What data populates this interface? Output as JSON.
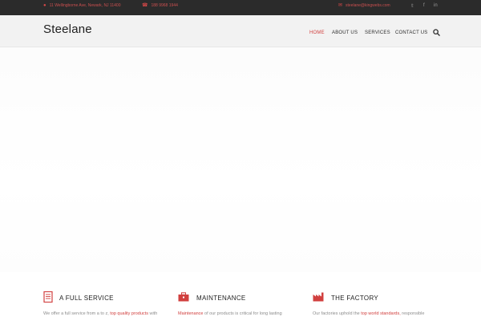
{
  "topbar": {
    "address": "11 Wellingborne Ave, Newark, NJ 11400",
    "phone": "188 9968 1944",
    "email": "steelane@kingwebs.com",
    "social": [
      "twitter-icon",
      "facebook-icon",
      "linkedin-icon"
    ]
  },
  "header": {
    "logo": "Steelane",
    "nav": [
      "HOME",
      "ABOUT US",
      "SERVICES",
      "CONTACT US"
    ],
    "active_index": 0
  },
  "features": [
    {
      "icon": "document-icon",
      "title": "A FULL SERVICE",
      "text_pre": "We offer a full service from a to z,",
      "highlight": "top quality products",
      "text_post": "with"
    },
    {
      "icon": "toolbox-icon",
      "title": "MAINTENANCE",
      "text_pre": "",
      "highlight": "Maintenance",
      "text_post": "of our products is critical for long lasting"
    },
    {
      "icon": "factory-icon",
      "title": "THE FACTORY",
      "text_pre": "Our factories uphold the",
      "highlight": "top world standards,",
      "text_post": "responsible"
    }
  ],
  "colors": {
    "accent": "#d1403f",
    "topbar_bg": "#2b2b2b",
    "header_bg": "#f2f2f2"
  }
}
